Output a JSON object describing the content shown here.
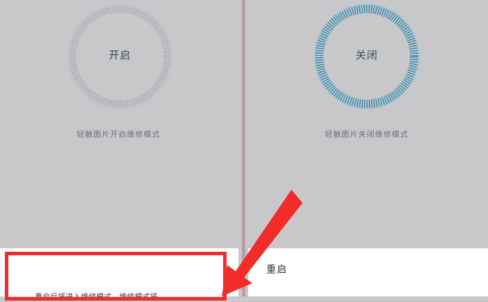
{
  "left_panel": {
    "button_label": "开启",
    "hint": "轻触图片开启维修模式",
    "ring_color": "#a9a9ad"
  },
  "right_panel": {
    "button_label": "关闭",
    "hint": "轻触图片关闭维修模式",
    "ring_color": "#3a8fb3"
  },
  "right_dialog": {
    "title": "重启"
  },
  "left_dialog": {
    "text": "重启后将进入维修模式，维修模式将……"
  },
  "annotation": {
    "highlight_color": "#f22b2b"
  }
}
